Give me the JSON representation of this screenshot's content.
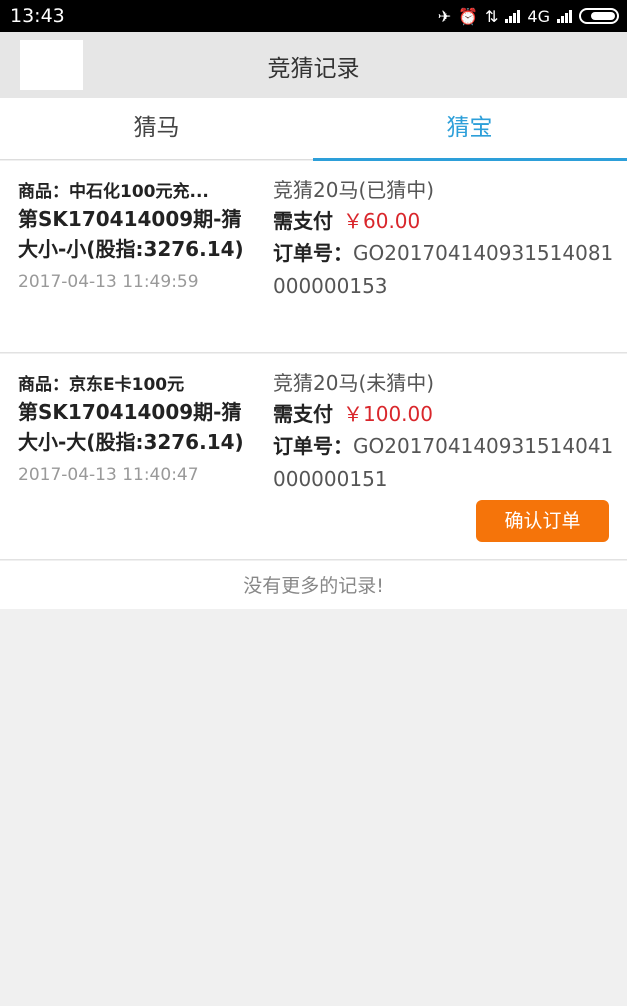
{
  "status_bar": {
    "time": "13:43",
    "network": "4G"
  },
  "header": {
    "title": "竞猜记录"
  },
  "tabs": [
    {
      "label": "猜马",
      "active": false
    },
    {
      "label": "猜宝",
      "active": true
    }
  ],
  "records": [
    {
      "goods": "商品：中石化100元充...",
      "period": "第SK170414009期-猜大小-小(股指:3276.14)",
      "date": "2017-04-13 11:49:59",
      "guess": "竞猜20马(已猜中)",
      "pay_label": "需支付",
      "pay_amount": "￥60.00",
      "order_label": "订单号：",
      "order_no": "GO201704140931514081000000153"
    },
    {
      "goods": "商品：京东E卡100元",
      "period": "第SK170414009期-猜大小-大(股指:3276.14)",
      "date": "2017-04-13 11:40:47",
      "guess": "竞猜20马(未猜中)",
      "pay_label": "需支付",
      "pay_amount": "￥100.00",
      "order_label": "订单号：",
      "order_no": "GO201704140931514041000000151",
      "action": "确认订单"
    }
  ],
  "footer_text": "没有更多的记录!",
  "colors": {
    "accent": "#2d9fd9",
    "price": "#d9262b",
    "button": "#f5740a"
  }
}
